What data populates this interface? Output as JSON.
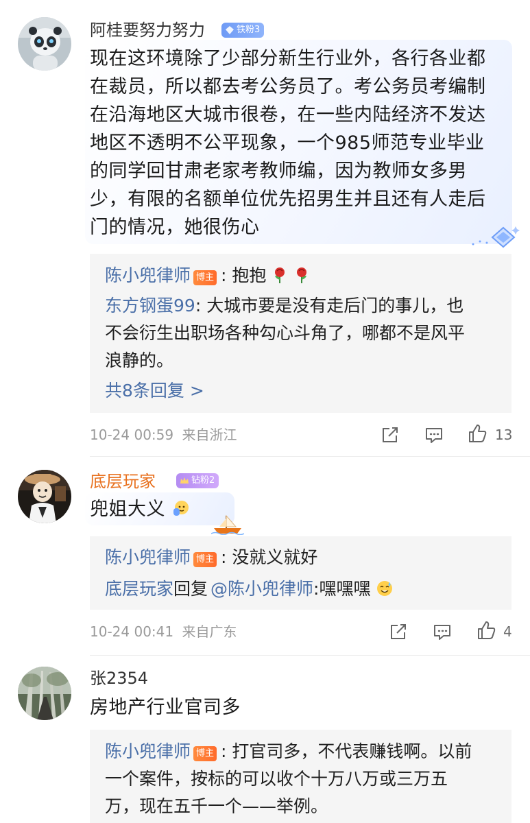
{
  "comments": [
    {
      "username": "阿桂要努力努力",
      "badge": "铁粉3",
      "content_lines": [
        "现在这环境除了少部分新生行业外，各行各业都",
        "在裁员，所以都去考公务员了。考公务员考编制",
        "在沿海地区大城市很卷，在一些内陆经济不发达",
        "地区不透明不公平现象，一个985师范专业毕业",
        "的同学回甘肃老家考教师编，因为教师女多男",
        "少，有限的名额单位优先招男生并且还有人走后",
        "门的情况，她很伤心"
      ],
      "replies": [
        {
          "author": "陈小兜律师",
          "host_tag": "博主",
          "sep": ": ",
          "text": "抱抱"
        },
        {
          "author": "东方钢蛋99",
          "sep": ": ",
          "text_lines": [
            "大城市要是没有走后门的事儿，也",
            "不会衍生出职场各种勾心斗角了，哪都不是风平",
            "浪静的。"
          ]
        }
      ],
      "more_replies": "共8条回复 >",
      "time": "10-24 00:59",
      "location": "来自浙江",
      "likes": "13"
    },
    {
      "username": "底层玩家",
      "badge": "钻粉2",
      "content": "兜姐大义",
      "replies": [
        {
          "author": "陈小兜律师",
          "host_tag": "博主",
          "sep": ": ",
          "text": "没就义就好"
        },
        {
          "author": "底层玩家",
          "reply_word": "回复",
          "mention": "@陈小兜律师",
          "sep": ":",
          "text": "嘿嘿嘿"
        }
      ],
      "time": "10-24 00:41",
      "location": "来自广东",
      "likes": "4"
    },
    {
      "username": "张2354",
      "content": "房地产行业官司多",
      "replies": [
        {
          "author": "陈小兜律师",
          "host_tag": "博主",
          "sep": ": ",
          "text_lines": [
            "打官司多，不代表赚钱啊。以前",
            "一个案件，按标的可以收个十万八万或三万五",
            "万，现在五千一个——举例。"
          ]
        }
      ]
    }
  ],
  "colors": {
    "link_blue": "#4a6fa8",
    "orange_name": "#e8711f",
    "reply_bg": "#f5f5f5",
    "meta_gray": "#9a9a9a"
  },
  "icons": [
    "share-icon",
    "comment-icon",
    "like-icon",
    "rose-icon",
    "hand-emoji-icon",
    "sweat-emoji-icon",
    "boat-decoration-icon",
    "diamond-decoration-icon"
  ]
}
